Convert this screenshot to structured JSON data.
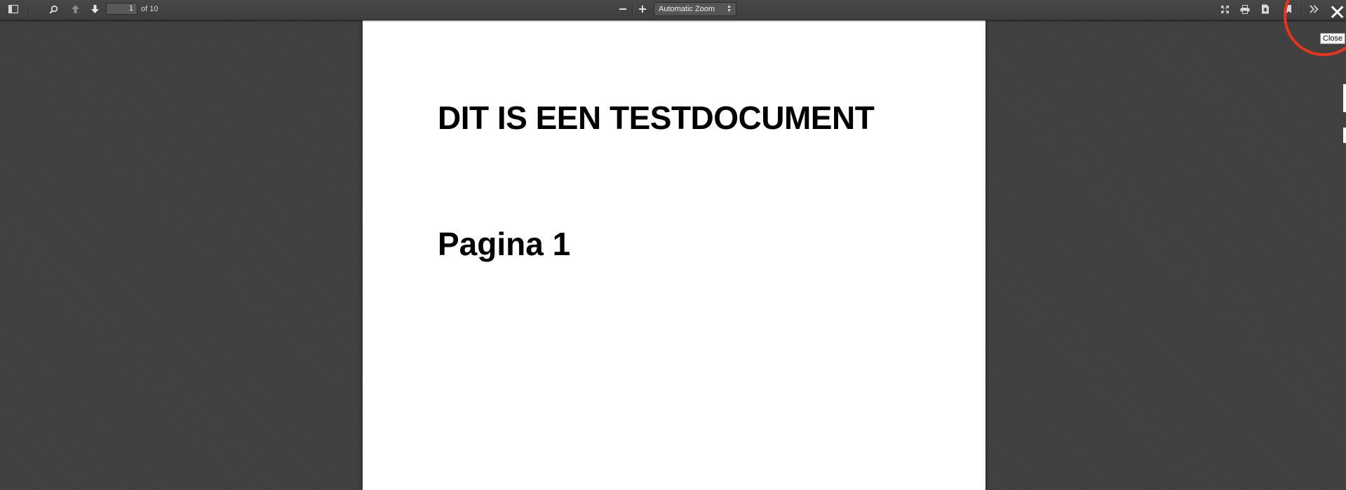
{
  "toolbar": {
    "sidebar_toggle_icon": "sidebar-icon",
    "find_icon": "search-icon",
    "previous_icon": "arrow-up-icon",
    "next_icon": "arrow-down-icon",
    "page_number": "1",
    "page_count": "of 10",
    "zoom_out_icon": "minus-icon",
    "zoom_in_icon": "plus-icon",
    "zoom_value": "Automatic Zoom",
    "presentation_icon": "fullscreen-icon",
    "print_icon": "print-icon",
    "download_icon": "download-icon",
    "bookmark_icon": "bookmark-icon",
    "tools_icon": "double-chevron-right-icon"
  },
  "overlay": {
    "close_glyph": "✕",
    "close_tooltip": "Close",
    "highlight_color": "#e8341c"
  },
  "document": {
    "title": "DIT IS EEN TESTDOCUMENT",
    "page_label": "Pagina 1"
  }
}
